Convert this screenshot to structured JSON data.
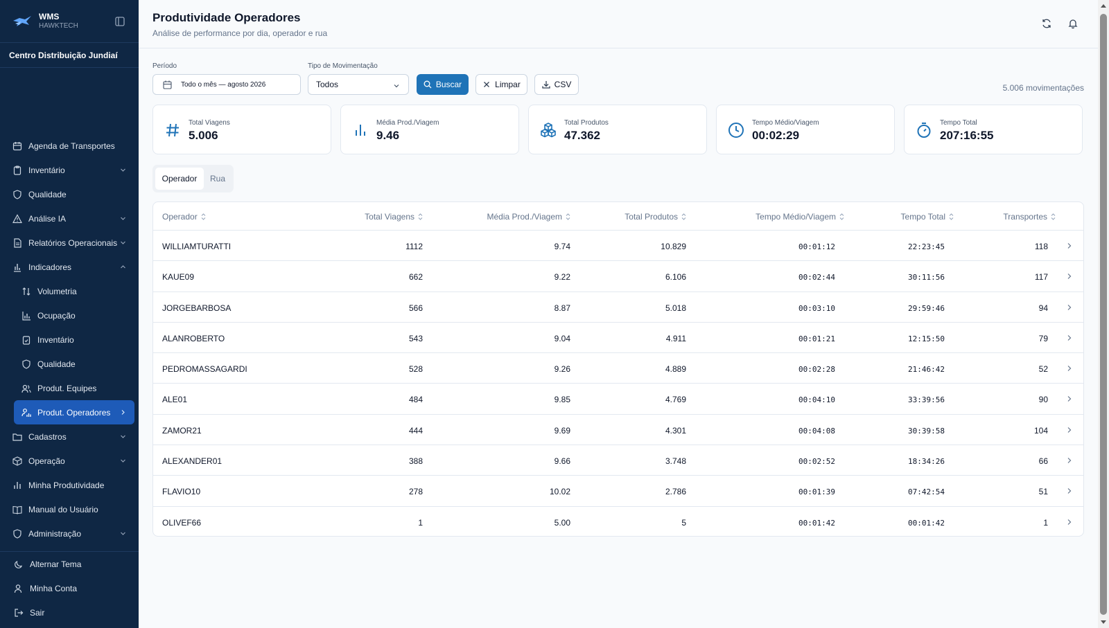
{
  "brand": {
    "name": "WMS",
    "company": "HAWKTECH"
  },
  "center": "Centro Distribuição Jundiaí",
  "nav": [
    {
      "label": "Agenda de Transportes",
      "icon": "calendar-icon",
      "chevron": false
    },
    {
      "label": "Inventário",
      "icon": "clipboard-icon",
      "chevron": true
    },
    {
      "label": "Qualidade",
      "icon": "shield-icon",
      "chevron": false
    },
    {
      "label": "Análise IA",
      "icon": "alert-triangle-icon",
      "chevron": true
    },
    {
      "label": "Relatórios Operacionais",
      "icon": "file-text-icon",
      "chevron": true
    },
    {
      "label": "Indicadores",
      "icon": "bar-chart-icon",
      "chevron": true
    }
  ],
  "subnav": [
    {
      "label": "Volumetria",
      "icon": "arrows-up-down-icon"
    },
    {
      "label": "Ocupação",
      "icon": "bar-chart-icon"
    },
    {
      "label": "Inventário",
      "icon": "clipboard-icon"
    },
    {
      "label": "Qualidade",
      "icon": "shield-icon"
    },
    {
      "label": "Produt. Equipes",
      "icon": "users-icon"
    },
    {
      "label": "Produt. Operadores",
      "icon": "user-chart-icon"
    }
  ],
  "nav2": [
    {
      "label": "Cadastros",
      "icon": "folder-icon",
      "chevron": true
    },
    {
      "label": "Operação",
      "icon": "box-icon",
      "chevron": true
    },
    {
      "label": "Minha Produtividade",
      "icon": "bar-chart-icon",
      "chevron": false
    },
    {
      "label": "Manual do Usuário",
      "icon": "book-icon",
      "chevron": false
    },
    {
      "label": "Administração",
      "icon": "shield-icon",
      "chevron": true
    }
  ],
  "bottom": [
    {
      "label": "Alternar Tema",
      "icon": "moon-icon"
    },
    {
      "label": "Minha Conta",
      "icon": "user-icon"
    },
    {
      "label": "Sair",
      "icon": "logout-icon"
    }
  ],
  "page": {
    "title": "Produtividade Operadores",
    "subtitle": "Análise de performance por dia, operador e rua"
  },
  "filters": {
    "period_label": "Período",
    "period_value": "Todo o mês — agosto 2026",
    "type_label": "Tipo de Movimentação",
    "type_value": "Todos",
    "search": "Buscar",
    "clear": "Limpar",
    "csv": "CSV",
    "count": "5.006 movimentações"
  },
  "kpis": [
    {
      "label": "Total Viagens",
      "value": "5.006",
      "icon": "hash-icon"
    },
    {
      "label": "Média Prod./Viagem",
      "value": "9.46",
      "icon": "bar-chart-icon"
    },
    {
      "label": "Total Produtos",
      "value": "47.362",
      "icon": "boxes-icon"
    },
    {
      "label": "Tempo Médio/Viagem",
      "value": "00:02:29",
      "icon": "clock-icon"
    },
    {
      "label": "Tempo Total",
      "value": "207:16:55",
      "icon": "timer-icon"
    }
  ],
  "tabs": [
    "Operador",
    "Rua"
  ],
  "table": {
    "headers": [
      "Operador",
      "Total Viagens",
      "Média Prod./Viagem",
      "Total Produtos",
      "Tempo Médio/Viagem",
      "Tempo Total",
      "Transportes"
    ],
    "rows": [
      [
        "WILLIAMTURATTI",
        "1112",
        "9.74",
        "10.829",
        "00:01:12",
        "22:23:45",
        "118"
      ],
      [
        "KAUE09",
        "662",
        "9.22",
        "6.106",
        "00:02:44",
        "30:11:56",
        "117"
      ],
      [
        "JORGEBARBOSA",
        "566",
        "8.87",
        "5.018",
        "00:03:10",
        "29:59:46",
        "94"
      ],
      [
        "ALANROBERTO",
        "543",
        "9.04",
        "4.911",
        "00:01:21",
        "12:15:50",
        "79"
      ],
      [
        "PEDROMASSAGARDI",
        "528",
        "9.26",
        "4.889",
        "00:02:28",
        "21:46:42",
        "52"
      ],
      [
        "ALE01",
        "484",
        "9.85",
        "4.769",
        "00:04:10",
        "33:39:56",
        "90"
      ],
      [
        "ZAMOR21",
        "444",
        "9.69",
        "4.301",
        "00:04:08",
        "30:39:58",
        "104"
      ],
      [
        "ALEXANDER01",
        "388",
        "9.66",
        "3.748",
        "00:02:52",
        "18:34:26",
        "66"
      ],
      [
        "FLAVIO10",
        "278",
        "10.02",
        "2.786",
        "00:01:39",
        "07:42:54",
        "51"
      ],
      [
        "OLIVEF66",
        "1",
        "5.00",
        "5",
        "00:01:42",
        "00:01:42",
        "1"
      ]
    ]
  },
  "colors": {
    "sidebar": "#0f2744",
    "accent": "#1f73b7",
    "active": "#1e5bb8"
  }
}
